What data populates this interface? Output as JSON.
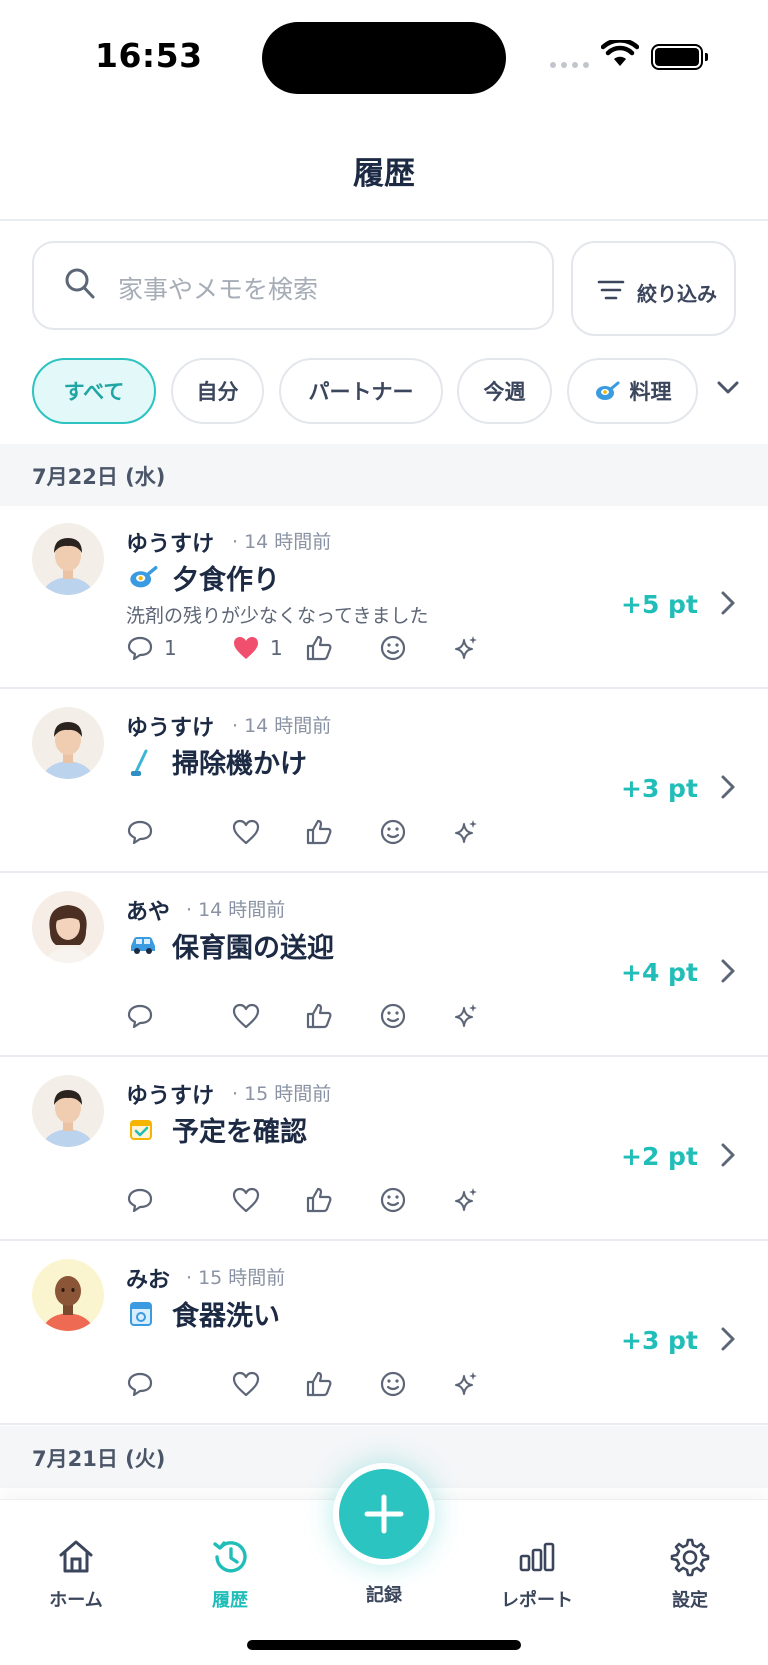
{
  "status_bar": {
    "time": "16:53"
  },
  "header": {
    "title": "履歴"
  },
  "search": {
    "placeholder": "家事やメモを検索",
    "filter_label": "絞り込み"
  },
  "chips": [
    {
      "label": "すべて",
      "active": true
    },
    {
      "label": "自分"
    },
    {
      "label": "パートナー"
    },
    {
      "label": "今週"
    },
    {
      "label": "料理",
      "icon": "frying-pan-icon"
    }
  ],
  "sections": [
    {
      "date": "7月22日 (水)"
    },
    {
      "date": "7月21日 (火)"
    }
  ],
  "items": [
    {
      "user": "ゆうすけ",
      "time": "· 14 時間前",
      "task": "夕食作り",
      "task_icon": "frying-pan-icon",
      "memo": "洗剤の残りが少なくなってきました",
      "points": "+5 pt",
      "comment_count": "1",
      "heart_count": "1",
      "liked": true
    },
    {
      "user": "ゆうすけ",
      "time": "· 14 時間前",
      "task": "掃除機かけ",
      "task_icon": "vacuum-icon",
      "memo": "",
      "points": "+3 pt"
    },
    {
      "user": "あや",
      "time": "· 14 時間前",
      "task": "保育園の送迎",
      "task_icon": "car-icon",
      "memo": "",
      "points": "+4 pt"
    },
    {
      "user": "ゆうすけ",
      "time": "· 15 時間前",
      "task": "予定を確認",
      "task_icon": "calendar-check-icon",
      "memo": "",
      "points": "+2 pt"
    },
    {
      "user": "みお",
      "time": "· 15 時間前",
      "task": "食器洗い",
      "task_icon": "dishwasher-icon",
      "memo": "",
      "points": "+3 pt"
    }
  ],
  "nav": {
    "home": "ホーム",
    "history": "履歴",
    "record": "記録",
    "report": "レポート",
    "settings": "設定"
  },
  "colors": {
    "accent": "#2bc4c0",
    "text": "#1d2a44",
    "heart": "#f0506e"
  }
}
